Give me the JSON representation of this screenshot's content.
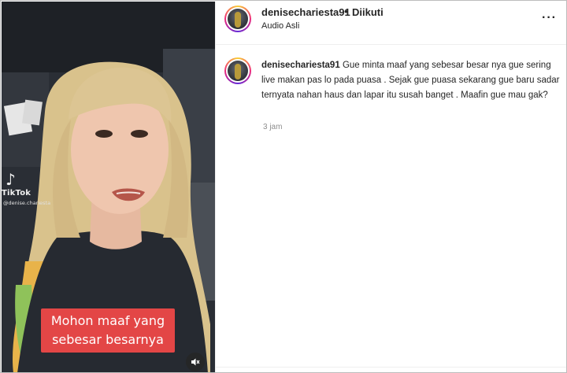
{
  "video": {
    "watermark": {
      "logo_glyph": "♪",
      "brand": "TikTok",
      "handle": "@denise.chariesta"
    },
    "caption_lines": [
      "Mohon maaf yang",
      "sebesar besarnya"
    ],
    "sound_icon": "speaker-muted-icon"
  },
  "header": {
    "username": "denisechariesta91",
    "separator": "•",
    "follow_status": "Diikuti",
    "audio_label": "Audio Asli",
    "more_glyph": "···"
  },
  "post": {
    "username": "denisechariesta91",
    "text": "Gue minta maaf yang sebesar besar nya gue sering live makan pas lo pada puasa . Sejak gue puasa sekarang gue baru sadar ternyata nahan haus dan lapar itu susah banget . Maafin gue mau gak?",
    "timestamp": "3 jam"
  },
  "colors": {
    "caption_bg": "#e34646",
    "text_primary": "#262626",
    "text_secondary": "#8e8e8e",
    "divider": "#efefef"
  }
}
